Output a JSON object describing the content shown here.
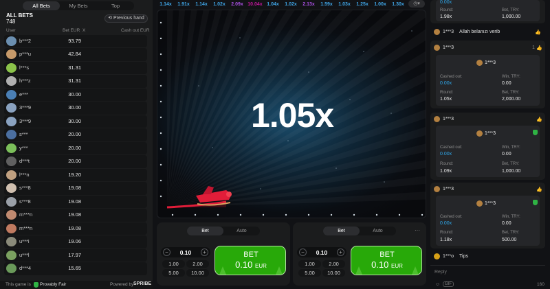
{
  "left": {
    "tabs": [
      "All Bets",
      "My Bets",
      "Top"
    ],
    "title": "ALL BETS",
    "count": "748",
    "prev_hand": "Previous hand",
    "col_user": "User",
    "col_bet": "Bet EUR",
    "col_x": "X",
    "col_cash": "Cash out EUR",
    "rows": [
      {
        "user": "b***2",
        "bet": "93.79",
        "color": "#6b8fb0"
      },
      {
        "user": "p***u",
        "bet": "42.84",
        "color": "#c79a6a"
      },
      {
        "user": "l***s",
        "bet": "31.31",
        "color": "#8bc34a"
      },
      {
        "user": "h***z",
        "bet": "31.31",
        "color": "#b0b0b0"
      },
      {
        "user": "e***",
        "bet": "30.00",
        "color": "#4a7fb5"
      },
      {
        "user": "3***9",
        "bet": "30.00",
        "color": "#8aa2c0"
      },
      {
        "user": "3***9",
        "bet": "30.00",
        "color": "#8aa2c0"
      },
      {
        "user": "s***",
        "bet": "20.00",
        "color": "#4b6fa0"
      },
      {
        "user": "y***",
        "bet": "20.00",
        "color": "#7bbf5a"
      },
      {
        "user": "d***t",
        "bet": "20.00",
        "color": "#606060"
      },
      {
        "user": "l***n",
        "bet": "19.20",
        "color": "#c0a080"
      },
      {
        "user": "s***8",
        "bet": "19.08",
        "color": "#d0c0b0"
      },
      {
        "user": "s***8",
        "bet": "19.08",
        "color": "#9aa0a8"
      },
      {
        "user": "m***n",
        "bet": "19.08",
        "color": "#c08a70"
      },
      {
        "user": "m***n",
        "bet": "19.08",
        "color": "#c07a60"
      },
      {
        "user": "u***i",
        "bet": "19.06",
        "color": "#8a8a7a"
      },
      {
        "user": "u***l",
        "bet": "17.97",
        "color": "#7aa060"
      },
      {
        "user": "d***4",
        "bet": "15.65",
        "color": "#6a9a5a"
      }
    ],
    "footer_game": "This game is",
    "footer_pf": "Provably Fair",
    "footer_powered": "Powered by",
    "footer_brand": "SPRIBE"
  },
  "history": [
    {
      "v": "1.14x",
      "c": "#3fa5e6"
    },
    {
      "v": "1.91x",
      "c": "#3fa5e6"
    },
    {
      "v": "1.14x",
      "c": "#3fa5e6"
    },
    {
      "v": "1.02x",
      "c": "#3fa5e6"
    },
    {
      "v": "2.09x",
      "c": "#a74fe0"
    },
    {
      "v": "10.04x",
      "c": "#c0179a"
    },
    {
      "v": "1.04x",
      "c": "#3fa5e6"
    },
    {
      "v": "1.02x",
      "c": "#3fa5e6"
    },
    {
      "v": "2.13x",
      "c": "#a74fe0"
    },
    {
      "v": "1.59x",
      "c": "#3fa5e6"
    },
    {
      "v": "1.03x",
      "c": "#3fa5e6"
    },
    {
      "v": "1.25x",
      "c": "#3fa5e6"
    },
    {
      "v": "1.00x",
      "c": "#3fa5e6"
    },
    {
      "v": "1.30x",
      "c": "#3fa5e6"
    }
  ],
  "game": {
    "multiplier": "1.05x"
  },
  "bet_panels": [
    {
      "tab_bet": "Bet",
      "tab_auto": "Auto",
      "amount": "0.10",
      "quick": [
        "1.00",
        "2.00",
        "5.00",
        "10.00"
      ],
      "btn_label": "BET",
      "btn_amount": "0.10",
      "btn_currency": "EUR",
      "more": ""
    },
    {
      "tab_bet": "Bet",
      "tab_auto": "Auto",
      "amount": "0.10",
      "quick": [
        "1.00",
        "2.00",
        "5.00",
        "10.00"
      ],
      "btn_label": "BET",
      "btn_amount": "0.10",
      "btn_currency": "EUR",
      "more": "···"
    }
  ],
  "chat": {
    "card0": {
      "cashed_val": "0.00x",
      "round_lbl": "Round:",
      "round_val": "1.98x",
      "bet_lbl": "Bet, TRY:",
      "bet_val": "1,000.00"
    },
    "msg1": {
      "user": "1***3",
      "text": "Allah belanızı verib"
    },
    "card1": {
      "user": "1***3",
      "count": "1",
      "inner_user": "1***3",
      "cashed_lbl": "Cashed out:",
      "cashed_val": "0.00x",
      "win_lbl": "Win, TRY:",
      "win_val": "0.00",
      "round_lbl": "Round:",
      "round_val": "1.05x",
      "bet_lbl": "Bet, TRY:",
      "bet_val": "2,000.00"
    },
    "card2": {
      "user": "1***3",
      "inner_user": "1***3",
      "cashed_lbl": "Cashed out:",
      "cashed_val": "0.00x",
      "win_lbl": "Win, TRY:",
      "win_val": "0.00",
      "round_lbl": "Round:",
      "round_val": "1.09x",
      "bet_lbl": "Bet, TRY:",
      "bet_val": "1,000.00"
    },
    "card3": {
      "user": "1***3",
      "inner_user": "1***3",
      "cashed_lbl": "Cashed out:",
      "cashed_val": "0.00x",
      "win_lbl": "Win, TRY:",
      "win_val": "0.00",
      "round_lbl": "Round:",
      "round_val": "1.18x",
      "bet_lbl": "Bet, TRY:",
      "bet_val": "500.00"
    },
    "msg2": {
      "user": "1***o",
      "text": "Tips"
    },
    "reply_placeholder": "Reply",
    "gif": "GIF",
    "chars_left": "160"
  }
}
